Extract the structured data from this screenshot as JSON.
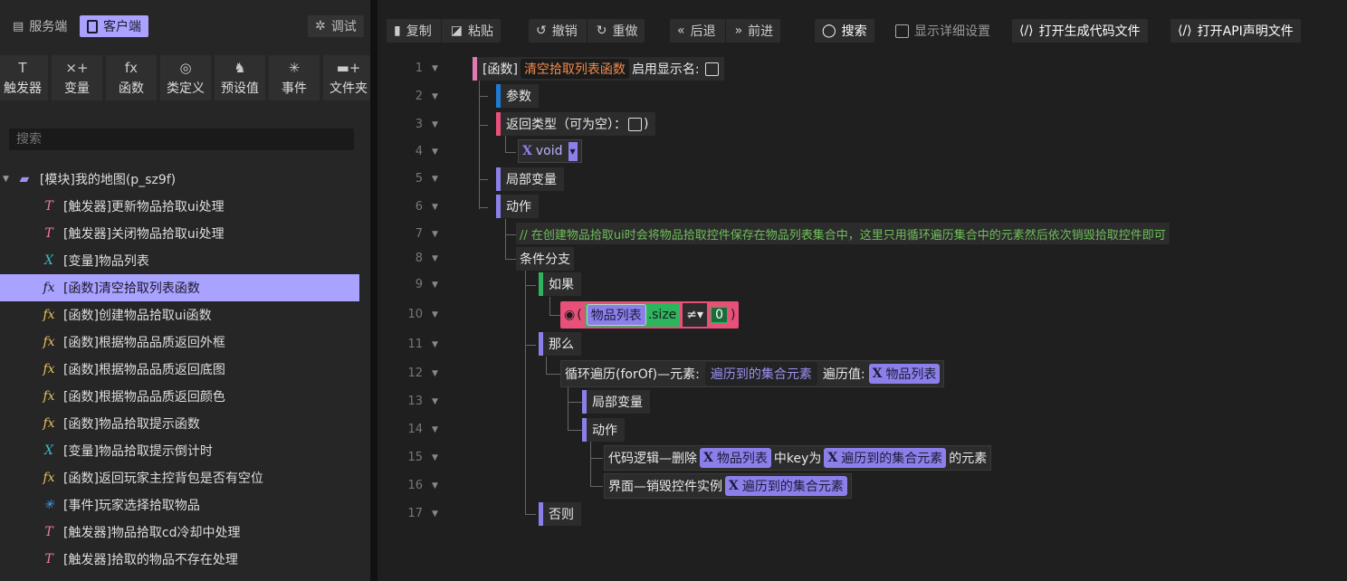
{
  "left": {
    "tabs": {
      "server": "服务端",
      "client": "客户端",
      "debug": "调试"
    },
    "tools": [
      {
        "label": "触发器",
        "icon": "trigger-icon",
        "glyph": "T"
      },
      {
        "label": "变量",
        "icon": "variable-icon",
        "glyph": "⨯+"
      },
      {
        "label": "函数",
        "icon": "function-icon",
        "glyph": "fx"
      },
      {
        "label": "类定义",
        "icon": "class-icon",
        "glyph": "◎"
      },
      {
        "label": "预设值",
        "icon": "preset-icon",
        "glyph": "♞"
      },
      {
        "label": "事件",
        "icon": "event-icon",
        "glyph": "✳"
      },
      {
        "label": "文件夹",
        "icon": "folder-add-icon",
        "glyph": "▬+"
      }
    ],
    "search_placeholder": "搜索",
    "root": "[模块]我的地图(p_sz9f)",
    "items": [
      {
        "kind": "trig",
        "glyph": "T",
        "label": "[触发器]更新物品拾取ui处理"
      },
      {
        "kind": "trig",
        "glyph": "T",
        "label": "[触发器]关闭物品拾取ui处理"
      },
      {
        "kind": "var",
        "glyph": "X",
        "label": "[变量]物品列表"
      },
      {
        "kind": "func",
        "glyph": "fx",
        "label": "[函数]清空拾取列表函数",
        "selected": true
      },
      {
        "kind": "func",
        "glyph": "fx",
        "label": "[函数]创建物品拾取ui函数"
      },
      {
        "kind": "func",
        "glyph": "fx",
        "label": "[函数]根据物品品质返回外框"
      },
      {
        "kind": "func",
        "glyph": "fx",
        "label": "[函数]根据物品品质返回底图"
      },
      {
        "kind": "func",
        "glyph": "fx",
        "label": "[函数]根据物品品质返回颜色"
      },
      {
        "kind": "func",
        "glyph": "fx",
        "label": "[函数]物品拾取提示函数"
      },
      {
        "kind": "var",
        "glyph": "X",
        "label": "[变量]物品拾取提示倒计时"
      },
      {
        "kind": "func",
        "glyph": "fx",
        "label": "[函数]返回玩家主控背包是否有空位"
      },
      {
        "kind": "evt",
        "glyph": "✳",
        "label": "[事件]玩家选择拾取物品"
      },
      {
        "kind": "trig",
        "glyph": "T",
        "label": "[触发器]物品拾取cd冷却中处理"
      },
      {
        "kind": "trig",
        "glyph": "T",
        "label": "[触发器]拾取的物品不存在处理"
      }
    ]
  },
  "toolbar": {
    "copy": "复制",
    "paste": "粘贴",
    "undo": "撤销",
    "redo": "重做",
    "back": "后退",
    "forward": "前进",
    "search": "搜索",
    "show_detail": "显示详细设置",
    "open_gen": "打开生成代码文件",
    "open_api": "打开API声明文件"
  },
  "code": {
    "line_numbers": [
      "1",
      "2",
      "3",
      "4",
      "5",
      "6",
      "7",
      "8",
      "9",
      "10",
      "11",
      "12",
      "13",
      "14",
      "15",
      "16",
      "17"
    ],
    "fn_tag": "[函数]",
    "fn_name": "清空拾取列表函数",
    "enable_display": "启用显示名:",
    "params": "参数",
    "return_type": "返回类型（可为空）：",
    "return_close": ")",
    "void": "void",
    "locals": "局部变量",
    "actions": "动作",
    "comment": "// 在创建物品拾取ui时会将物品拾取控件保存在物品列表集合中，这里只用循环遍历集合中的元素然后依次销毁拾取控件即可",
    "branch": "条件分支",
    "if": "如果",
    "cond_var": "物品列表",
    "cond_prop": ".size",
    "cond_op": "≠▾",
    "cond_val": "0",
    "then": "那么",
    "loop_label": "循环遍历(forOf)—元素:",
    "loop_elem": "遍历到的集合元素",
    "loop_val_label": "遍历值:",
    "loop_val": "物品列表",
    "inner_locals": "局部变量",
    "inner_actions": "动作",
    "del_label": "代码逻辑—删除",
    "del_list": "物品列表",
    "del_mid": "中key为",
    "del_key": "遍历到的集合元素",
    "del_end": "的元素",
    "ui_label": "界面—销毁控件实例",
    "ui_elem": "遍历到的集合元素",
    "else": "否则"
  },
  "colors": {
    "accent": "#a9a2ff",
    "pink": "#e8507a",
    "green": "#2db55d",
    "blue": "#1f7ad1",
    "comment": "#6fbf5a",
    "fnname": "#f08a4b"
  }
}
